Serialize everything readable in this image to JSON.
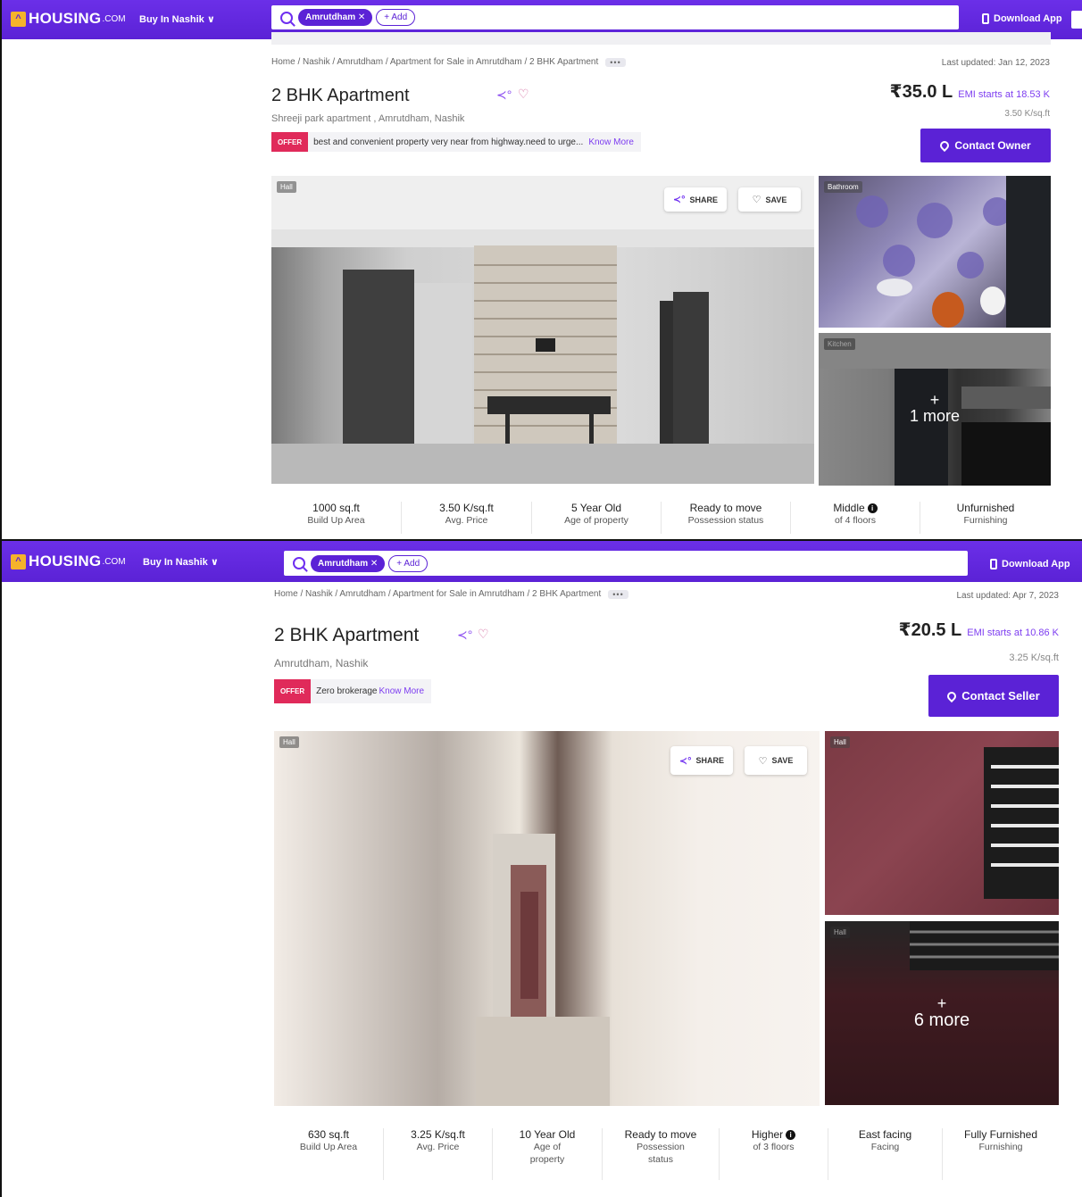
{
  "header": {
    "logo_main": "HOUSING",
    "logo_suffix": ".COM",
    "city_selector": "Buy In Nashik",
    "search_chip": "Amrutdham",
    "add_chip": "+ Add",
    "download_app": "Download App"
  },
  "listing1": {
    "breadcrumb": "Home / Nashik / Amrutdham / Apartment for Sale in Amrutdham / 2 BHK Apartment",
    "breadcrumb_more": "•••",
    "last_updated": "Last updated: Jan 12, 2023",
    "title": "2 BHK Apartment",
    "address": "Shreeji park apartment , Amrutdham, Nashik",
    "offer_tag": "OFFER",
    "offer_text": "best and convenient property very near from highway.need to urge...",
    "offer_link": "Know More",
    "price": "₹35.0 L",
    "emi": "EMI starts at  18.53 K",
    "price_per_sqft": "3.50 K/sq.ft",
    "contact_button": "Contact Owner",
    "photos": {
      "main_tag": "Hall",
      "side_top_tag": "Bathroom",
      "side_bottom_tag": "Kitchen",
      "more_plus": "+",
      "more_text": "1 more",
      "share": "SHARE",
      "save": "SAVE"
    },
    "stats": [
      {
        "value": "1000 sq.ft",
        "label": "Build Up Area"
      },
      {
        "value": "3.50 K/sq.ft",
        "label": "Avg. Price"
      },
      {
        "value": "5 Year Old",
        "label": "Age of property"
      },
      {
        "value": "Ready to move",
        "label": "Possession status"
      },
      {
        "value": "Middle",
        "label": "of 4 floors"
      },
      {
        "value": "Unfurnished",
        "label": "Furnishing"
      }
    ]
  },
  "listing2": {
    "breadcrumb": "Home / Nashik / Amrutdham / Apartment for Sale in Amrutdham / 2 BHK Apartment",
    "breadcrumb_more": "•••",
    "last_updated": "Last updated: Apr 7, 2023",
    "title": "2 BHK Apartment",
    "address": "Amrutdham, Nashik",
    "offer_tag": "OFFER",
    "offer_text": "Zero brokerage",
    "offer_link": "Know More",
    "price": "₹20.5 L",
    "emi": "EMI starts at  10.86 K",
    "price_per_sqft": "3.25 K/sq.ft",
    "contact_button": "Contact Seller",
    "photos": {
      "main_tag": "Hall",
      "side_top_tag": "Hall",
      "side_bottom_tag": "Hall",
      "more_plus": "+",
      "more_text": "6 more",
      "share": "SHARE",
      "save": "SAVE"
    },
    "stats": [
      {
        "value": "630 sq.ft",
        "label": "Build Up Area"
      },
      {
        "value": "3.25 K/sq.ft",
        "label": "Avg. Price"
      },
      {
        "value": "10 Year Old",
        "label": "Age of property"
      },
      {
        "value": "Ready to move",
        "label": "Possession status"
      },
      {
        "value": "Higher",
        "label": "of 3 floors"
      },
      {
        "value": "East facing",
        "label": "Facing"
      },
      {
        "value": "Fully Furnished",
        "label": "Furnishing"
      }
    ]
  },
  "colors": {
    "brand_purple": "#5b22d6",
    "offer_red": "#e02a5a",
    "logo_yellow": "#f5b32b"
  }
}
